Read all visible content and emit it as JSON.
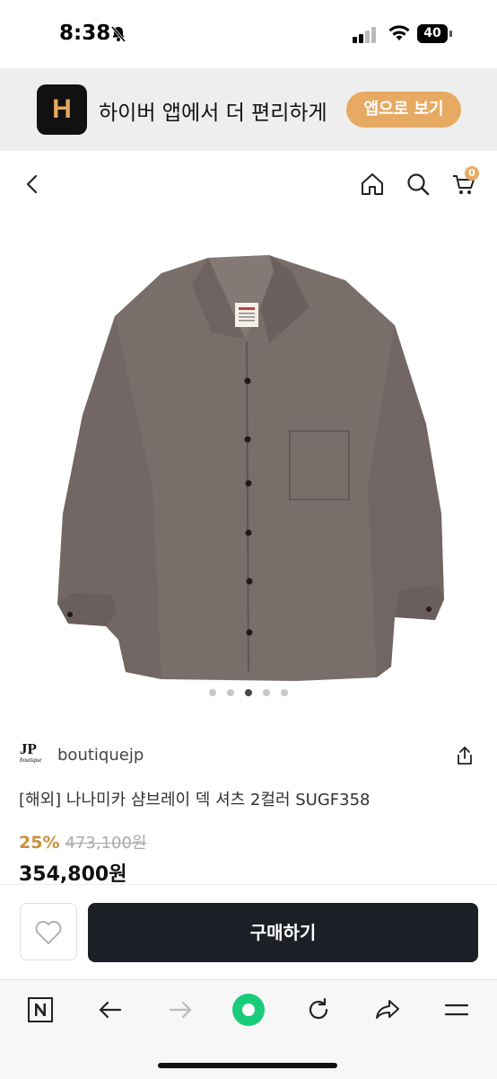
{
  "status_bar": {
    "time": "8:38",
    "battery": "40"
  },
  "app_banner": {
    "logo_letter": "H",
    "text": "하이버 앱에서 더 편리하게",
    "open_app_label": "앱으로 보기",
    "accent_color": "#e6aa63"
  },
  "nav": {
    "cart_count": "0",
    "icons": [
      "back-icon",
      "home-icon",
      "search-icon",
      "cart-icon"
    ]
  },
  "gallery": {
    "image_description_icon": "shirt-image",
    "current_slide": 3,
    "slide_count": 5
  },
  "seller": {
    "logo_text": "JP",
    "logo_subtext": "boutique",
    "name": "boutiquejp"
  },
  "product": {
    "title": "[해외] 나나미카 샴브레이 덱 셔츠 2컬러 SUGF358",
    "discount_rate": "25%",
    "original_price": "473,100원",
    "final_price": "354,800원"
  },
  "buy_bar": {
    "buy_label": "구매하기",
    "wish_icon": "heart-icon"
  },
  "browser_bar": {
    "icons": [
      "naver-icon",
      "back-arrow-icon",
      "forward-arrow-icon",
      "green-dot-icon",
      "refresh-icon",
      "share-arrow-icon",
      "menu-icon"
    ]
  }
}
